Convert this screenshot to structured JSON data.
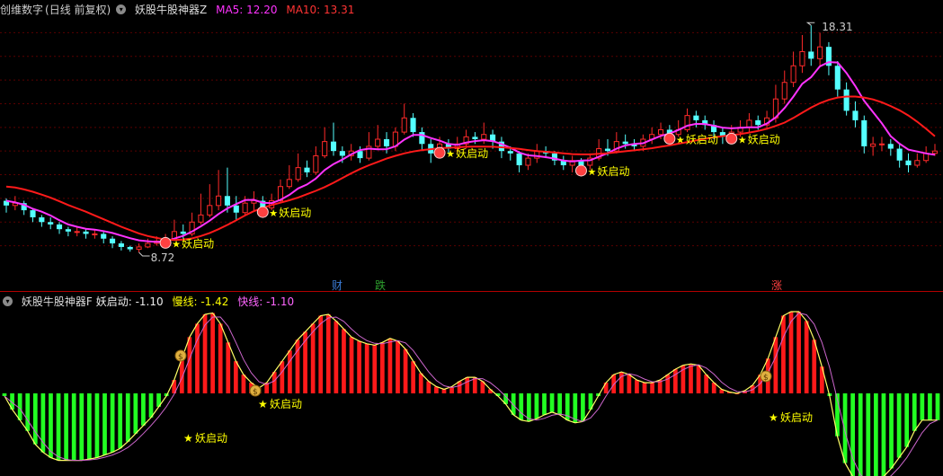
{
  "top_panel": {
    "title": "创维数字",
    "period": "(日线 前复权)",
    "indicator": "妖股牛股神器Z",
    "ma5_label": "MA5: 12.20",
    "ma10_label": "MA10: 13.31"
  },
  "bottom_panel": {
    "indicator": "妖股牛股神器F",
    "start_label": "妖启动: -1.10",
    "slow_label": "慢线: -1.42",
    "fast_label": "快线: -1.10"
  },
  "colors": {
    "up": "#ff2a2a",
    "down": "#54ffff",
    "ma5": "#ff33ff",
    "ma10": "#ff1a1a",
    "hist_pos": "#ff1a1a",
    "hist_neg": "#22ff22",
    "fast": "#ffff66",
    "slow": "#cc66cc",
    "signal_text": "#ffff00",
    "header_text": "#cccccc",
    "ma5_text": "#ff33ff",
    "ma10_text": "#ff3333",
    "fast_text": "#ff66ff"
  },
  "chart_data": [
    {
      "type": "candlestick",
      "title": "创维数字 (日线 前复权)",
      "ylim": [
        8.0,
        19.0
      ],
      "grid": true,
      "candles": [
        [
          10.9,
          10.7,
          11.0,
          10.4
        ],
        [
          10.7,
          10.8,
          11.1,
          10.5
        ],
        [
          10.8,
          10.5,
          10.9,
          10.3
        ],
        [
          10.5,
          10.2,
          10.6,
          10.0
        ],
        [
          10.2,
          10.0,
          10.3,
          9.8
        ],
        [
          10.0,
          9.9,
          10.2,
          9.7
        ],
        [
          9.9,
          9.7,
          10.0,
          9.5
        ],
        [
          9.7,
          9.6,
          9.8,
          9.4
        ],
        [
          9.6,
          9.6,
          9.8,
          9.4
        ],
        [
          9.6,
          9.5,
          9.7,
          9.3
        ],
        [
          9.5,
          9.5,
          9.7,
          9.3
        ],
        [
          9.5,
          9.3,
          9.6,
          9.1
        ],
        [
          9.3,
          9.1,
          9.4,
          8.9
        ],
        [
          9.1,
          8.95,
          9.2,
          8.8
        ],
        [
          8.95,
          8.85,
          9.0,
          8.75
        ],
        [
          8.85,
          8.95,
          9.1,
          8.72
        ],
        [
          8.95,
          9.1,
          9.3,
          8.9
        ],
        [
          9.1,
          9.2,
          9.4,
          9.0
        ],
        [
          9.2,
          9.3,
          9.5,
          9.1
        ],
        [
          9.3,
          9.6,
          10.1,
          9.2
        ],
        [
          9.6,
          9.5,
          9.9,
          9.3
        ],
        [
          9.5,
          10.0,
          10.4,
          9.4
        ],
        [
          10.0,
          10.3,
          11.2,
          9.9
        ],
        [
          10.3,
          10.7,
          11.6,
          10.2
        ],
        [
          10.7,
          11.1,
          12.2,
          10.5
        ],
        [
          11.1,
          10.7,
          12.3,
          10.4
        ],
        [
          10.7,
          10.4,
          11.1,
          10.1
        ],
        [
          10.4,
          10.8,
          11.1,
          10.3
        ],
        [
          10.8,
          10.9,
          11.3,
          10.5
        ],
        [
          10.9,
          10.6,
          11.1,
          10.4
        ],
        [
          10.6,
          10.9,
          11.2,
          10.5
        ],
        [
          10.9,
          11.5,
          11.8,
          10.8
        ],
        [
          11.5,
          11.8,
          12.4,
          11.4
        ],
        [
          11.8,
          12.3,
          12.9,
          11.7
        ],
        [
          12.3,
          12.1,
          12.6,
          11.9
        ],
        [
          12.1,
          12.8,
          13.2,
          12.0
        ],
        [
          12.8,
          13.4,
          14.0,
          12.7
        ],
        [
          13.4,
          13.0,
          14.2,
          12.8
        ],
        [
          13.0,
          12.8,
          13.2,
          12.5
        ],
        [
          12.8,
          13.0,
          13.3,
          12.6
        ],
        [
          13.0,
          12.7,
          13.2,
          12.5
        ],
        [
          12.7,
          13.2,
          13.8,
          12.6
        ],
        [
          13.2,
          13.5,
          14.1,
          13.1
        ],
        [
          13.5,
          13.2,
          13.8,
          12.9
        ],
        [
          13.2,
          13.8,
          14.0,
          13.0
        ],
        [
          13.8,
          14.4,
          15.0,
          13.7
        ],
        [
          14.4,
          13.8,
          14.6,
          13.6
        ],
        [
          13.8,
          13.3,
          14.0,
          13.0
        ],
        [
          13.3,
          12.9,
          13.5,
          12.5
        ],
        [
          12.9,
          13.3,
          13.6,
          12.7
        ],
        [
          13.3,
          13.1,
          13.5,
          12.9
        ],
        [
          13.1,
          13.3,
          13.6,
          12.9
        ],
        [
          13.3,
          13.6,
          13.9,
          13.1
        ],
        [
          13.6,
          13.5,
          13.8,
          13.3
        ],
        [
          13.5,
          13.7,
          14.2,
          13.3
        ],
        [
          13.7,
          13.4,
          13.9,
          13.1
        ],
        [
          13.4,
          13.0,
          13.6,
          12.7
        ],
        [
          13.0,
          12.9,
          13.2,
          12.6
        ],
        [
          12.9,
          12.4,
          13.0,
          12.1
        ],
        [
          12.4,
          12.7,
          12.9,
          12.2
        ],
        [
          12.7,
          13.0,
          13.3,
          12.5
        ],
        [
          13.0,
          12.9,
          13.2,
          12.7
        ],
        [
          12.9,
          12.6,
          13.0,
          12.4
        ],
        [
          12.6,
          12.4,
          12.8,
          12.2
        ],
        [
          12.4,
          12.6,
          12.8,
          12.1
        ],
        [
          12.6,
          12.4,
          12.7,
          12.1
        ],
        [
          12.4,
          12.7,
          12.9,
          12.2
        ],
        [
          12.7,
          13.1,
          13.5,
          12.6
        ],
        [
          13.1,
          13.0,
          13.5,
          12.8
        ],
        [
          13.0,
          13.4,
          13.8,
          12.9
        ],
        [
          13.4,
          13.3,
          13.7,
          13.1
        ],
        [
          13.3,
          13.2,
          13.5,
          13.0
        ],
        [
          13.2,
          13.5,
          13.7,
          13.0
        ],
        [
          13.5,
          13.7,
          14.0,
          13.3
        ],
        [
          13.7,
          13.9,
          14.2,
          13.5
        ],
        [
          13.9,
          13.7,
          14.1,
          13.5
        ],
        [
          13.7,
          13.9,
          14.3,
          13.6
        ],
        [
          13.9,
          14.5,
          14.8,
          13.8
        ],
        [
          14.5,
          14.3,
          14.7,
          14.0
        ],
        [
          14.3,
          14.1,
          14.5,
          13.9
        ],
        [
          14.1,
          13.8,
          14.3,
          13.5
        ],
        [
          13.8,
          13.6,
          14.0,
          13.3
        ],
        [
          13.6,
          13.8,
          14.1,
          13.4
        ],
        [
          13.8,
          14.0,
          14.3,
          13.6
        ],
        [
          14.0,
          14.3,
          14.6,
          13.8
        ],
        [
          14.3,
          14.1,
          14.5,
          13.9
        ],
        [
          14.1,
          14.4,
          14.7,
          13.9
        ],
        [
          14.4,
          15.2,
          15.8,
          14.2
        ],
        [
          15.2,
          15.9,
          16.4,
          15.0
        ],
        [
          15.9,
          16.6,
          17.2,
          15.7
        ],
        [
          16.6,
          17.2,
          17.9,
          16.3
        ],
        [
          17.2,
          16.9,
          18.31,
          16.6
        ],
        [
          16.9,
          17.4,
          18.0,
          16.6
        ],
        [
          17.4,
          16.6,
          17.6,
          16.2
        ],
        [
          16.6,
          15.6,
          16.8,
          15.3
        ],
        [
          15.6,
          14.7,
          15.9,
          14.5
        ],
        [
          14.7,
          14.3,
          15.1,
          14.0
        ],
        [
          14.3,
          13.2,
          14.5,
          12.9
        ],
        [
          13.2,
          13.3,
          13.6,
          12.8
        ],
        [
          13.3,
          13.3,
          13.6,
          13.0
        ],
        [
          13.3,
          13.1,
          13.5,
          12.8
        ],
        [
          13.1,
          12.6,
          13.3,
          12.3
        ],
        [
          12.6,
          12.4,
          12.9,
          12.1
        ],
        [
          12.4,
          12.6,
          12.9,
          12.3
        ],
        [
          12.6,
          12.9,
          13.2,
          12.5
        ],
        [
          12.9,
          13.0,
          13.3,
          12.8
        ]
      ],
      "series": [
        {
          "name": "MA5",
          "values": [
            10.9,
            10.83,
            10.73,
            10.56,
            10.44,
            10.28,
            10.08,
            9.9,
            9.8,
            9.72,
            9.68,
            9.62,
            9.54,
            9.43,
            9.32,
            9.23,
            9.19,
            9.16,
            9.19,
            9.3,
            9.42,
            9.6,
            9.82,
            10.06,
            10.34,
            10.58,
            10.76,
            10.93,
            10.94,
            10.82,
            10.8,
            10.94,
            11.15,
            11.42,
            11.59,
            11.84,
            12.2,
            12.45,
            12.64,
            12.86,
            13.04,
            13.1,
            13.07,
            13.08,
            13.2,
            13.48,
            13.68,
            13.68,
            13.55,
            13.44,
            13.3,
            13.26,
            13.36,
            13.42,
            13.46,
            13.42,
            13.3,
            13.14,
            12.94,
            12.82,
            12.79,
            12.74,
            12.68,
            12.6,
            12.56,
            12.6,
            12.61,
            12.76,
            12.91,
            13.1,
            13.24,
            13.3,
            13.33,
            13.49,
            13.64,
            13.74,
            13.89,
            14.07,
            14.15,
            14.14,
            14.07,
            13.99,
            13.96,
            13.98,
            14.0,
            14.0,
            14.16,
            14.42,
            14.82,
            15.3,
            15.84,
            16.12,
            16.58,
            16.76,
            16.74,
            16.3,
            15.74,
            15.12,
            14.65,
            14.17,
            13.63,
            13.31,
            13.06,
            12.98,
            12.9,
            12.84
          ]
        },
        {
          "name": "MA10",
          "values": [
            11.5,
            11.46,
            11.38,
            11.28,
            11.16,
            11.03,
            10.88,
            10.72,
            10.58,
            10.44,
            10.28,
            10.12,
            9.96,
            9.8,
            9.66,
            9.52,
            9.41,
            9.33,
            9.26,
            9.24,
            9.26,
            9.31,
            9.41,
            9.54,
            9.7,
            9.88,
            10.08,
            10.28,
            10.46,
            10.6,
            10.72,
            10.82,
            10.92,
            11.04,
            11.18,
            11.32,
            11.48,
            11.66,
            11.86,
            12.06,
            12.24,
            12.4,
            12.54,
            12.68,
            12.8,
            12.9,
            12.98,
            13.04,
            13.08,
            13.12,
            13.14,
            13.16,
            13.18,
            13.19,
            13.19,
            13.18,
            13.16,
            13.13,
            13.09,
            13.04,
            13.0,
            12.97,
            12.94,
            12.9,
            12.87,
            12.86,
            12.86,
            12.88,
            12.91,
            12.95,
            12.99,
            13.03,
            13.07,
            13.12,
            13.18,
            13.24,
            13.31,
            13.38,
            13.45,
            13.52,
            13.58,
            13.63,
            13.67,
            13.72,
            13.78,
            13.85,
            13.94,
            14.06,
            14.2,
            14.4,
            14.62,
            14.84,
            15.02,
            15.16,
            15.26,
            15.3,
            15.3,
            15.26,
            15.18,
            15.06,
            14.9,
            14.72,
            14.5,
            14.24,
            13.94,
            13.62
          ]
        }
      ],
      "annotations": {
        "high_label": "18.31",
        "low_label": "8.72",
        "signal_text": "妖启动",
        "markers": [
          "财",
          "跌",
          "涨"
        ]
      }
    },
    {
      "type": "bar",
      "title": "妖股牛股神器F",
      "ylim": [
        -3.5,
        3.2
      ],
      "series": [
        {
          "name": "妖启动",
          "values": [
            -0.1,
            -0.6,
            -1.0,
            -1.4,
            -1.9,
            -2.2,
            -2.4,
            -2.5,
            -2.5,
            -2.5,
            -2.5,
            -2.45,
            -2.4,
            -2.3,
            -2.2,
            -2.05,
            -1.8,
            -1.5,
            -1.2,
            -0.9,
            -0.5,
            -0.1,
            0.5,
            1.3,
            2.1,
            2.6,
            2.95,
            3.0,
            2.6,
            1.9,
            1.2,
            0.7,
            0.4,
            0.2,
            0.4,
            0.8,
            1.2,
            1.6,
            2.0,
            2.3,
            2.6,
            2.9,
            2.95,
            2.7,
            2.4,
            2.1,
            1.95,
            1.85,
            1.8,
            1.9,
            2.05,
            1.95,
            1.65,
            1.2,
            0.75,
            0.45,
            0.25,
            0.15,
            0.25,
            0.45,
            0.6,
            0.6,
            0.45,
            0.15,
            -0.1,
            -0.4,
            -0.8,
            -1.0,
            -1.05,
            -0.95,
            -0.8,
            -0.7,
            -0.8,
            -1.0,
            -1.1,
            -1.05,
            -0.6,
            -0.1,
            0.4,
            0.7,
            0.8,
            0.7,
            0.5,
            0.4,
            0.4,
            0.5,
            0.7,
            0.9,
            1.05,
            1.1,
            1.05,
            0.7,
            0.4,
            0.15,
            0.05,
            0.0,
            0.1,
            0.3,
            0.7,
            1.3,
            2.1,
            2.9,
            3.05,
            3.05,
            2.7,
            2.0,
            1.0,
            -0.1,
            -1.6,
            -2.6,
            -3.1,
            -3.4,
            -3.4,
            -3.3,
            -3.1,
            -2.8,
            -2.4,
            -2.0,
            -1.4,
            -1.0,
            -1.0,
            -1.0
          ]
        },
        {
          "name": "慢线",
          "values": [
            -1.42
          ]
        },
        {
          "name": "快线",
          "values": [
            -1.1
          ]
        }
      ],
      "annotations": {
        "signal_text": "妖启动"
      }
    }
  ]
}
